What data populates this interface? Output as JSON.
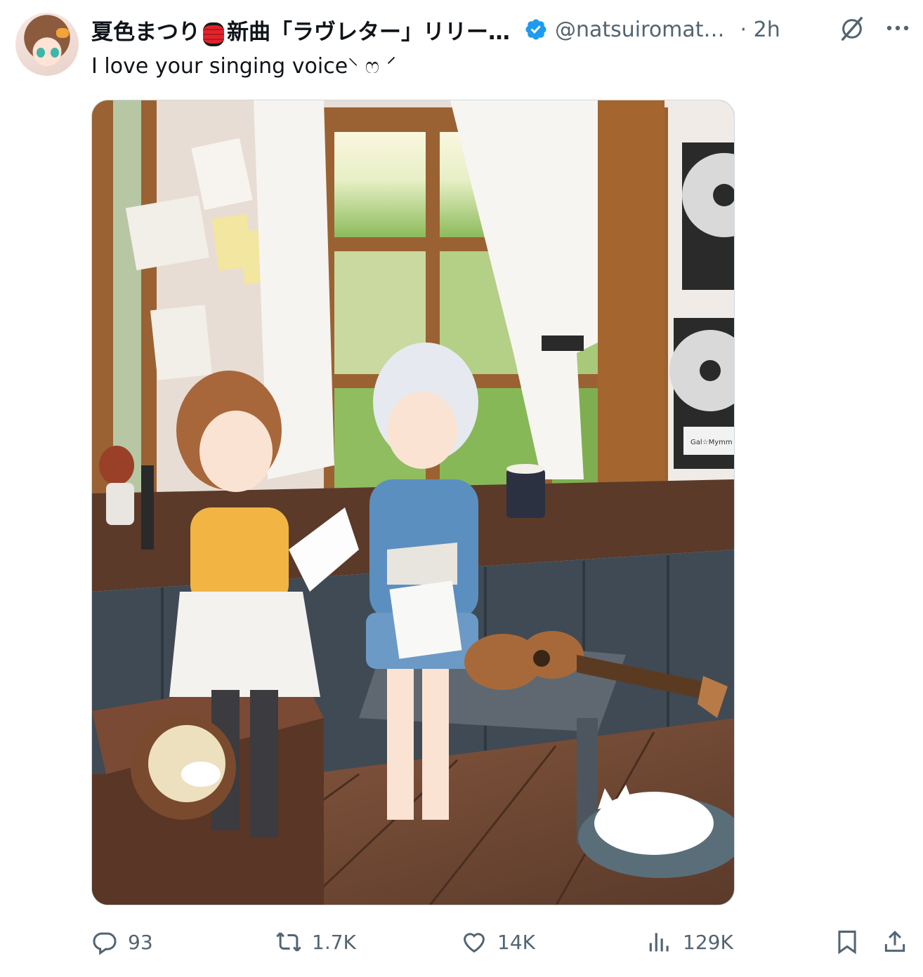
{
  "author": {
    "display_name_part1": "夏色まつり",
    "display_name_part2": "新曲「ラヴレター」リリー…",
    "handle": "@natsuiromat…",
    "time": "· 2h"
  },
  "tweet": {
    "text": "I love your singing voice⸌ ෆ ⸍"
  },
  "media": {
    "signature": "Gal☆Mymm"
  },
  "stats": {
    "replies": "93",
    "reposts": "1.7K",
    "likes": "14K",
    "views": "129K"
  },
  "colors": {
    "verified": "#1d9bf0",
    "secondary_text": "#536471",
    "primary_text": "#0f1419"
  },
  "icons": [
    "avatar",
    "lantern-emoji",
    "verified-badge-icon",
    "grok-icon",
    "more-icon",
    "reply-icon",
    "repost-icon",
    "like-icon",
    "views-icon",
    "bookmark-icon",
    "share-icon"
  ]
}
